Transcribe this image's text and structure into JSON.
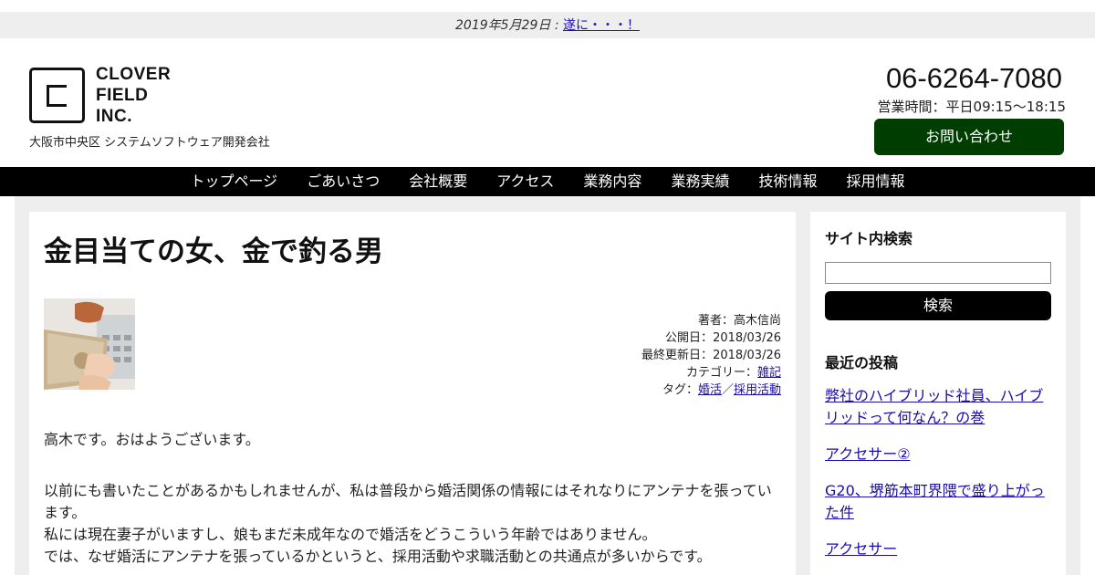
{
  "notice": {
    "date": "2019年5月29日 : ",
    "link": "遂に・・・！"
  },
  "header": {
    "logo_lines": [
      "CLOVER",
      "FIELD",
      "INC."
    ],
    "tagline": "大阪市中央区 システムソフトウェア開発会社",
    "phone": "06-6264-7080",
    "hours": "営業時間：平日09:15〜18:15",
    "inquiry_label": "お問い合わせ"
  },
  "nav": [
    "トップページ",
    "ごあいさつ",
    "会社概要",
    "アクセス",
    "業務内容",
    "業務実績",
    "技術情報",
    "採用情報"
  ],
  "article": {
    "title": "金目当ての女、金で釣る男",
    "meta": {
      "author_label": "著者：",
      "author": "高木信尚",
      "published_label": "公開日：",
      "published": "2018/03/26",
      "updated_label": "最終更新日：",
      "updated": "2018/03/26",
      "category_label": "カテゴリー：",
      "category": "雑記",
      "tag_label": "タグ：",
      "tag1": "婚活",
      "tag_sep": "／",
      "tag2": "採用活動"
    },
    "para1": "高木です。おはようございます。",
    "para2_lines": [
      "以前にも書いたことがあるかもしれませんが、私は普段から婚活関係の情報にはそれなりにアンテナを張ってい",
      "ます。",
      "私には現在妻子がいますし、娘もまだ未成年なので婚活をどうこういう年齢ではありません。",
      "では、なぜ婚活にアンテナを張っているかというと、採用活動や求職活動との共通点が多いからです。"
    ]
  },
  "sidebar": {
    "search_heading": "サイト内検索",
    "search_button": "検索",
    "recent_heading": "最近の投稿",
    "posts": [
      "弊社のハイブリッド社員、ハイブリッドって何なん？の巻",
      "アクセサー②",
      "G20、堺筋本町界隈で盛り上がった件",
      "アクセサー"
    ]
  }
}
